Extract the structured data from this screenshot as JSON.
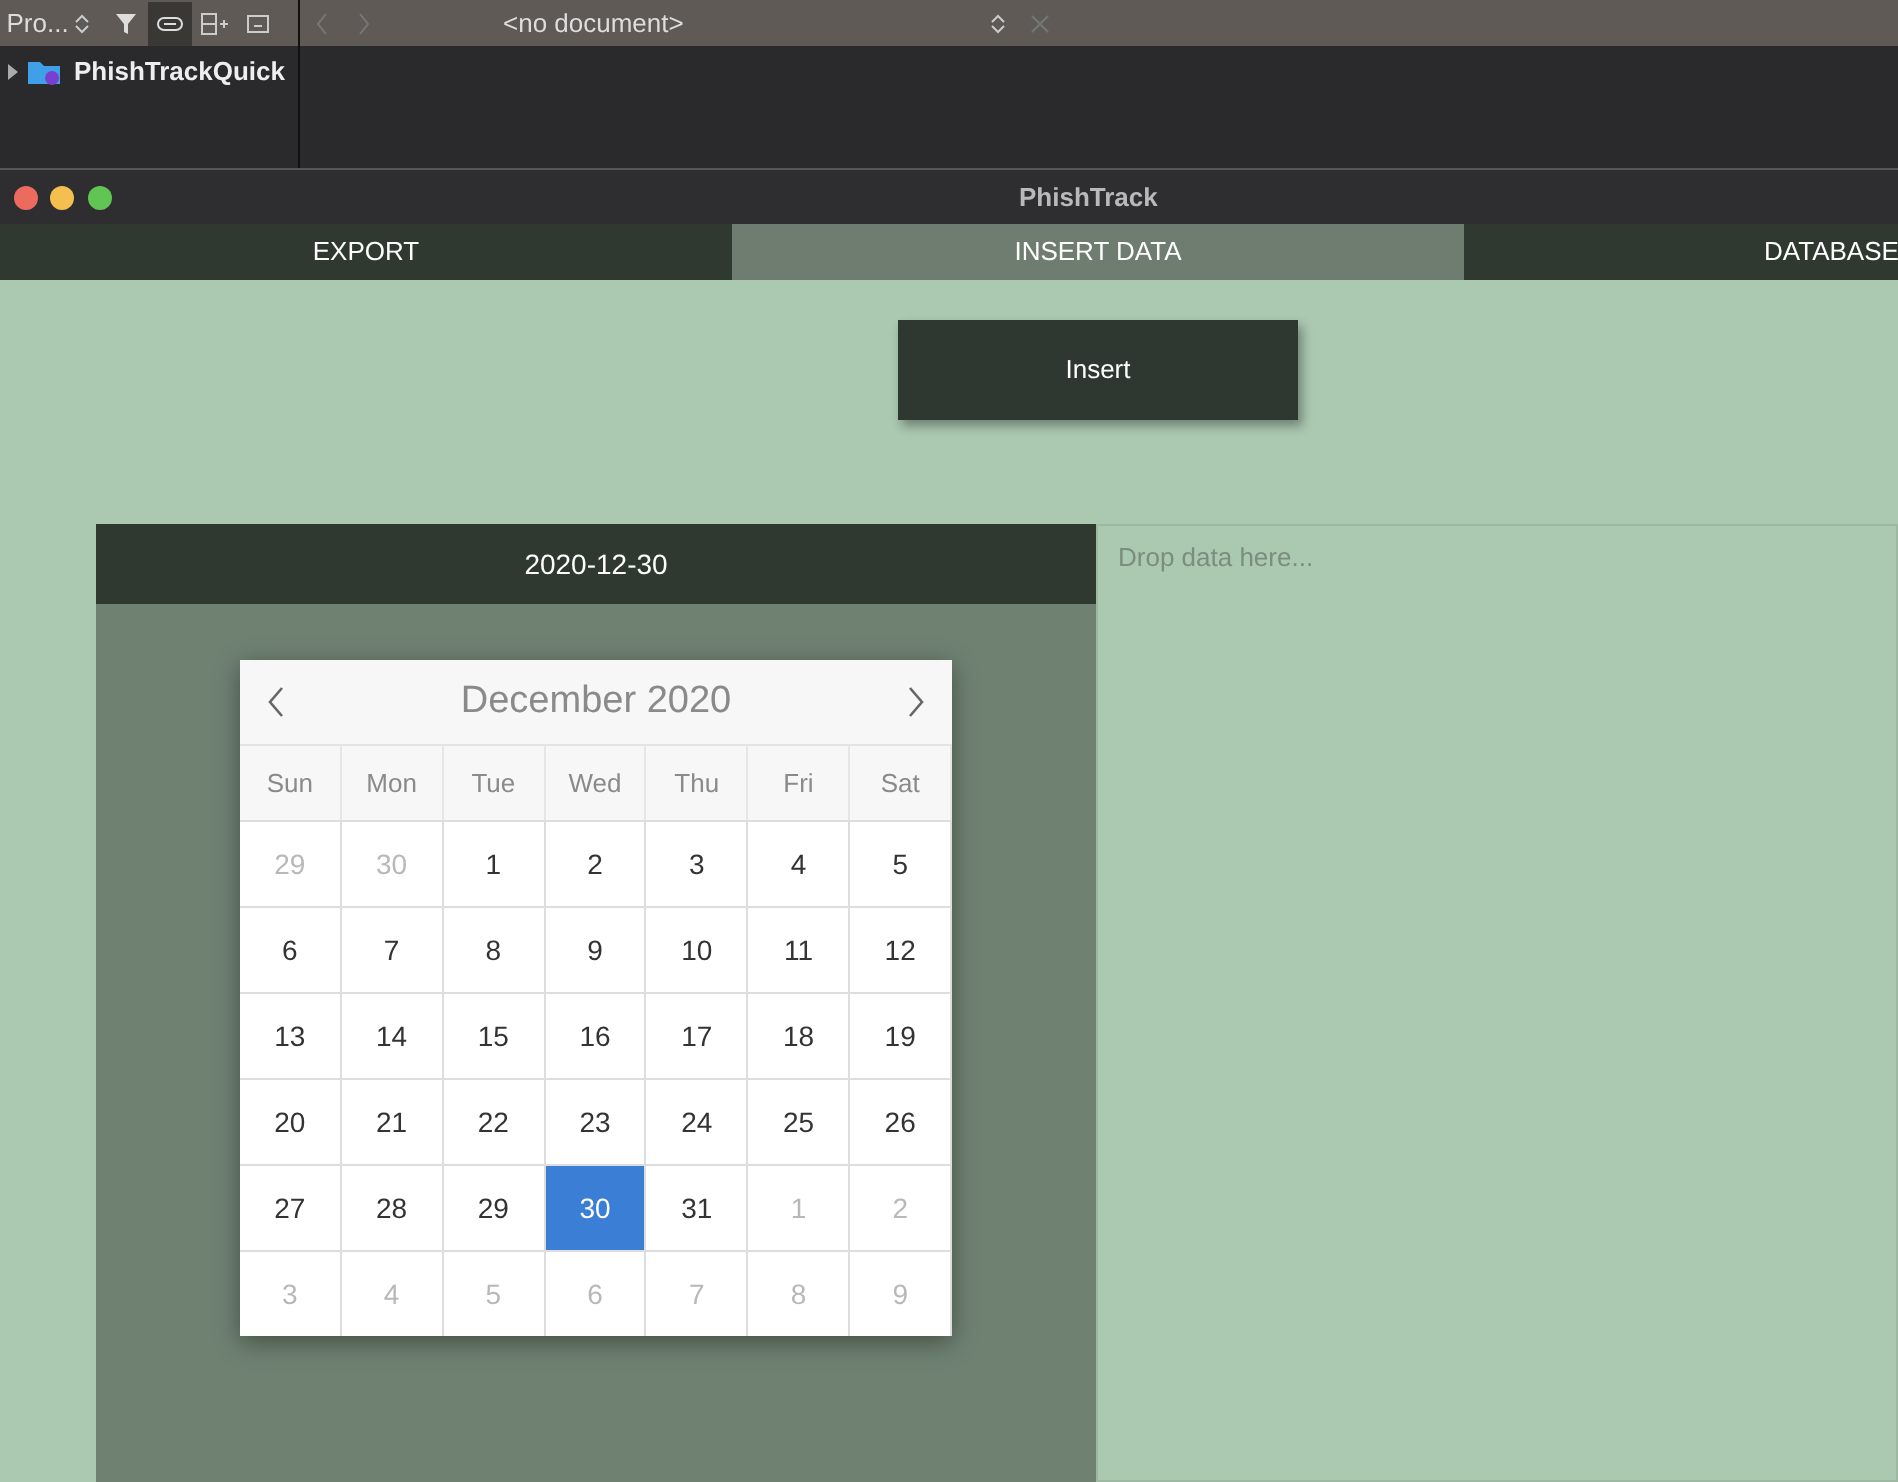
{
  "ide_toolbar": {
    "navigator_label": "Pro...",
    "document_label": "<no document>"
  },
  "project_tree": {
    "items": [
      {
        "label": "PhishTrackQuick",
        "expanded": false
      }
    ]
  },
  "window": {
    "title": "PhishTrack"
  },
  "tabs": [
    {
      "label": "EXPORT",
      "selected": false
    },
    {
      "label": "INSERT DATA",
      "selected": true
    },
    {
      "label": "DATABASE",
      "selected": false
    }
  ],
  "insert_button": "Insert",
  "date_header": "2020-12-30",
  "calendar": {
    "month_title": "December 2020",
    "weekdays": [
      "Sun",
      "Mon",
      "Tue",
      "Wed",
      "Thu",
      "Fri",
      "Sat"
    ],
    "weeks": [
      [
        {
          "day": "29",
          "outside": true,
          "selected": false
        },
        {
          "day": "30",
          "outside": true,
          "selected": false
        },
        {
          "day": "1",
          "outside": false,
          "selected": false
        },
        {
          "day": "2",
          "outside": false,
          "selected": false
        },
        {
          "day": "3",
          "outside": false,
          "selected": false
        },
        {
          "day": "4",
          "outside": false,
          "selected": false
        },
        {
          "day": "5",
          "outside": false,
          "selected": false
        }
      ],
      [
        {
          "day": "6",
          "outside": false,
          "selected": false
        },
        {
          "day": "7",
          "outside": false,
          "selected": false
        },
        {
          "day": "8",
          "outside": false,
          "selected": false
        },
        {
          "day": "9",
          "outside": false,
          "selected": false
        },
        {
          "day": "10",
          "outside": false,
          "selected": false
        },
        {
          "day": "11",
          "outside": false,
          "selected": false
        },
        {
          "day": "12",
          "outside": false,
          "selected": false
        }
      ],
      [
        {
          "day": "13",
          "outside": false,
          "selected": false
        },
        {
          "day": "14",
          "outside": false,
          "selected": false
        },
        {
          "day": "15",
          "outside": false,
          "selected": false
        },
        {
          "day": "16",
          "outside": false,
          "selected": false
        },
        {
          "day": "17",
          "outside": false,
          "selected": false
        },
        {
          "day": "18",
          "outside": false,
          "selected": false
        },
        {
          "day": "19",
          "outside": false,
          "selected": false
        }
      ],
      [
        {
          "day": "20",
          "outside": false,
          "selected": false
        },
        {
          "day": "21",
          "outside": false,
          "selected": false
        },
        {
          "day": "22",
          "outside": false,
          "selected": false
        },
        {
          "day": "23",
          "outside": false,
          "selected": false
        },
        {
          "day": "24",
          "outside": false,
          "selected": false
        },
        {
          "day": "25",
          "outside": false,
          "selected": false
        },
        {
          "day": "26",
          "outside": false,
          "selected": false
        }
      ],
      [
        {
          "day": "27",
          "outside": false,
          "selected": false
        },
        {
          "day": "28",
          "outside": false,
          "selected": false
        },
        {
          "day": "29",
          "outside": false,
          "selected": false
        },
        {
          "day": "30",
          "outside": false,
          "selected": true
        },
        {
          "day": "31",
          "outside": false,
          "selected": false
        },
        {
          "day": "1",
          "outside": true,
          "selected": false
        },
        {
          "day": "2",
          "outside": true,
          "selected": false
        }
      ],
      [
        {
          "day": "3",
          "outside": true,
          "selected": false
        },
        {
          "day": "4",
          "outside": true,
          "selected": false
        },
        {
          "day": "5",
          "outside": true,
          "selected": false
        },
        {
          "day": "6",
          "outside": true,
          "selected": false
        },
        {
          "day": "7",
          "outside": true,
          "selected": false
        },
        {
          "day": "8",
          "outside": true,
          "selected": false
        },
        {
          "day": "9",
          "outside": true,
          "selected": false
        }
      ]
    ]
  },
  "drop_area": {
    "placeholder": "Drop data here..."
  }
}
